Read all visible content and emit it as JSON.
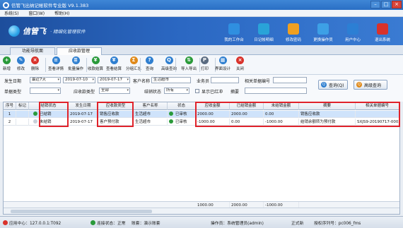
{
  "window": {
    "title": "信管飞出纳记帐软件专业版 V9.1.383"
  },
  "menu": [
    "系统(S)",
    "窗口(W)",
    "帮助(H)"
  ],
  "banner": {
    "brand": "信管飞",
    "slogan": "· 精细化管理软件",
    "quick": [
      {
        "label": "我的工作台",
        "icon": "monitor-icon",
        "color": "#2f8fe0"
      },
      {
        "label": "日记帐明细",
        "icon": "ledger-icon",
        "color": "#29a3d8"
      },
      {
        "label": "修改密码",
        "icon": "lock-icon",
        "color": "#f0a020"
      },
      {
        "label": "更换操作员",
        "icon": "user-switch-icon",
        "color": "#3da0e6"
      },
      {
        "label": "用户中心",
        "icon": "user-center-icon",
        "color": "#2c7fd4"
      },
      {
        "label": "退出系统",
        "icon": "power-icon",
        "color": "#d9322b"
      }
    ]
  },
  "tabs": [
    "功能导航面",
    "应收款管理"
  ],
  "toolbar": [
    {
      "label": "新增",
      "icon": "plus-icon",
      "color": "#2a9a3a",
      "glyph": "+"
    },
    {
      "label": "修改",
      "icon": "edit-icon",
      "color": "#2f7fd0",
      "glyph": "✎"
    },
    {
      "label": "删除",
      "icon": "delete-icon",
      "color": "#d9322b",
      "glyph": "×"
    },
    {
      "label": "查看详情",
      "icon": "view-icon",
      "color": "#2f7fd0",
      "glyph": "≡"
    },
    {
      "label": "批量操作",
      "icon": "batch-icon",
      "color": "#2f7fd0",
      "glyph": "≣"
    },
    {
      "label": "收款结算",
      "icon": "collect-icon",
      "color": "#2a9a3a",
      "glyph": "¥"
    },
    {
      "label": "查看结算",
      "icon": "settle-view-icon",
      "color": "#2f7fd0",
      "glyph": "¥"
    },
    {
      "label": "分组汇总",
      "icon": "group-icon",
      "color": "#e08a1a",
      "glyph": "Σ"
    },
    {
      "label": "查询",
      "icon": "query-icon",
      "color": "#2f7fd0",
      "glyph": "?"
    },
    {
      "label": "高级查询",
      "icon": "advanced-query-icon",
      "color": "#2f7fd0",
      "glyph": "Q"
    },
    {
      "label": "导入导出",
      "icon": "import-export-icon",
      "color": "#2a9a3a",
      "glyph": "⇅"
    },
    {
      "label": "打印",
      "icon": "print-icon",
      "color": "#5a6b80",
      "glyph": "P"
    },
    {
      "label": "界面设计",
      "icon": "design-icon",
      "color": "#2f7fd0",
      "glyph": "▦"
    },
    {
      "label": "关闭",
      "icon": "close-icon",
      "color": "#d9322b",
      "glyph": "×"
    }
  ],
  "filters": {
    "date_label": "发生日期",
    "date_range": "最近7天",
    "date_from": "2019-07-10",
    "date_to": "2019-07-17",
    "customer_label": "客户名称",
    "customer": "生活超市",
    "staff_label": "业务员",
    "staff": "",
    "related_no_label": "相关单据编号",
    "related_no": "",
    "doc_type_label": "单据类型",
    "doc_type": "",
    "ar_type_label": "应收款类型",
    "ar_type": "全部",
    "settle_status_label": "结销状态",
    "settle_status": "所有",
    "show_red_label": "显示已红冲",
    "summary_label": "摘要",
    "summary": "",
    "query_btn": "查询(Q)",
    "adv_query_btn": "高级查询"
  },
  "table": {
    "columns": [
      "序号",
      "标记",
      "结销状态",
      "发生日期",
      "应收款类型",
      "客户名称",
      "状态",
      "应收金额",
      "已结销金额",
      "未结销金额",
      "摘要",
      "相关单据编号"
    ],
    "rows": [
      {
        "no": "1",
        "mark": "",
        "settle": "已结销",
        "settle_color": "#2a9a3a",
        "date": "2019-07-17",
        "type": "销售应收款",
        "customer": "生活超市",
        "status": "已审核",
        "amount": "2000.00",
        "settled": "2000.00",
        "unsettled": "0.00",
        "summary": "销售应收款",
        "related": ""
      },
      {
        "no": "2",
        "mark": "",
        "settle": "未结销",
        "settle_color": "#c8d0da",
        "date": "2019-07-17",
        "type": "客户预付款",
        "customer": "生活超市",
        "status": "已审核",
        "amount": "-1000.00",
        "settled": "0.00",
        "unsettled": "-1000.00",
        "summary": "结销余额转为预付款",
        "related": "SXJS9-20190717-0002"
      }
    ],
    "totals": {
      "amount": "1000.00",
      "settled": "2000.00",
      "unsettled": "-1000.00"
    }
  },
  "statusbar": {
    "app_center": "应用中心：127.0.0.1:T092",
    "connection": "连接状态：正常",
    "account": "账套：演示账套",
    "operator": "操作员：系统管理员(admin)",
    "edition": "正式新",
    "license": "授权序列号：pc006_fms"
  }
}
